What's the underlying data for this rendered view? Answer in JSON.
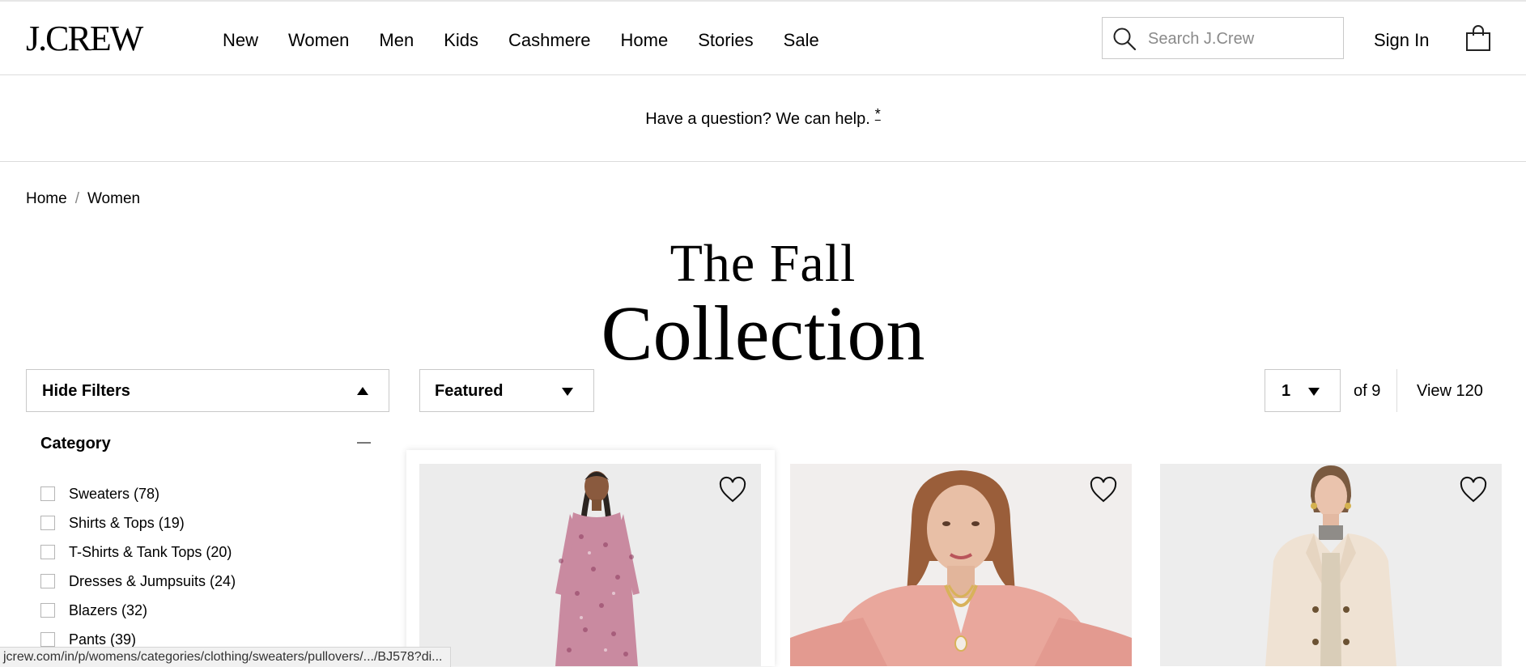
{
  "header": {
    "logo": "J.CREW",
    "nav": [
      "New",
      "Women",
      "Men",
      "Kids",
      "Cashmere",
      "Home",
      "Stories",
      "Sale"
    ],
    "search_placeholder": "Search J.Crew",
    "sign_in": "Sign In"
  },
  "promo": {
    "text": "Have a question? We can help.",
    "link": "*"
  },
  "breadcrumb": {
    "items": [
      "Home",
      "Women"
    ],
    "separator": "/"
  },
  "hero": {
    "line1": "The Fall",
    "line2": "Collection"
  },
  "controls": {
    "hide_filters": "Hide Filters",
    "sort": "Featured",
    "page": "1",
    "of_pages": "of 9",
    "view_all": "View 120"
  },
  "filters": {
    "category_title": "Category",
    "items": [
      "Sweaters (78)",
      "Shirts & Tops (19)",
      "T-Shirts & Tank Tops (20)",
      "Dresses & Jumpsuits (24)",
      "Blazers (32)",
      "Pants (39)"
    ]
  },
  "products": [
    {
      "name": "floral-midi-dress",
      "icon": "heart-icon"
    },
    {
      "name": "pink-cardigan-sweater",
      "icon": "heart-icon"
    },
    {
      "name": "cream-wool-coat",
      "icon": "heart-icon"
    }
  ],
  "status_bar": {
    "url": "jcrew.com/in/p/womens/categories/clothing/sweaters/pullovers/.../BJ578?di..."
  },
  "colors": {
    "text": "#000000",
    "border": "#c9c9c9",
    "divider": "#dcdcdc",
    "photo_bg": "#f2f2f2"
  }
}
